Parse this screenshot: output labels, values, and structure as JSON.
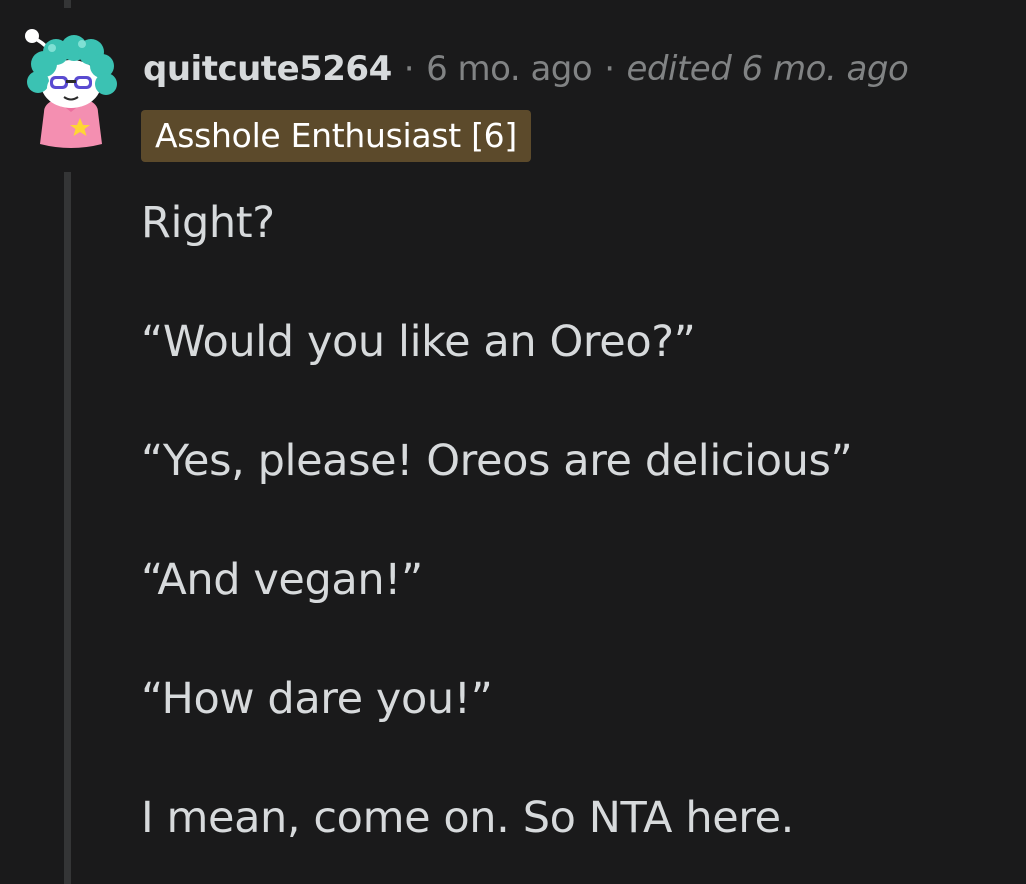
{
  "comment": {
    "author": "quitcute5264",
    "separator": "·",
    "time": "6 mo. ago",
    "edited": "edited 6 mo. ago",
    "flair": "Asshole Enthusiast [6]",
    "avatar_icon": "snoo-avatar-icon",
    "colors": {
      "background": "#1a1a1b",
      "flair_bg": "#5c4a2b",
      "text": "#d7dadc",
      "meta": "#818384"
    },
    "paragraphs": [
      "Right?",
      "“Would you like an Oreo?”",
      "“Yes, please! Oreos are delicious”",
      "“And vegan!”",
      "“How dare you!”",
      "I mean, come on. So NTA here."
    ]
  }
}
